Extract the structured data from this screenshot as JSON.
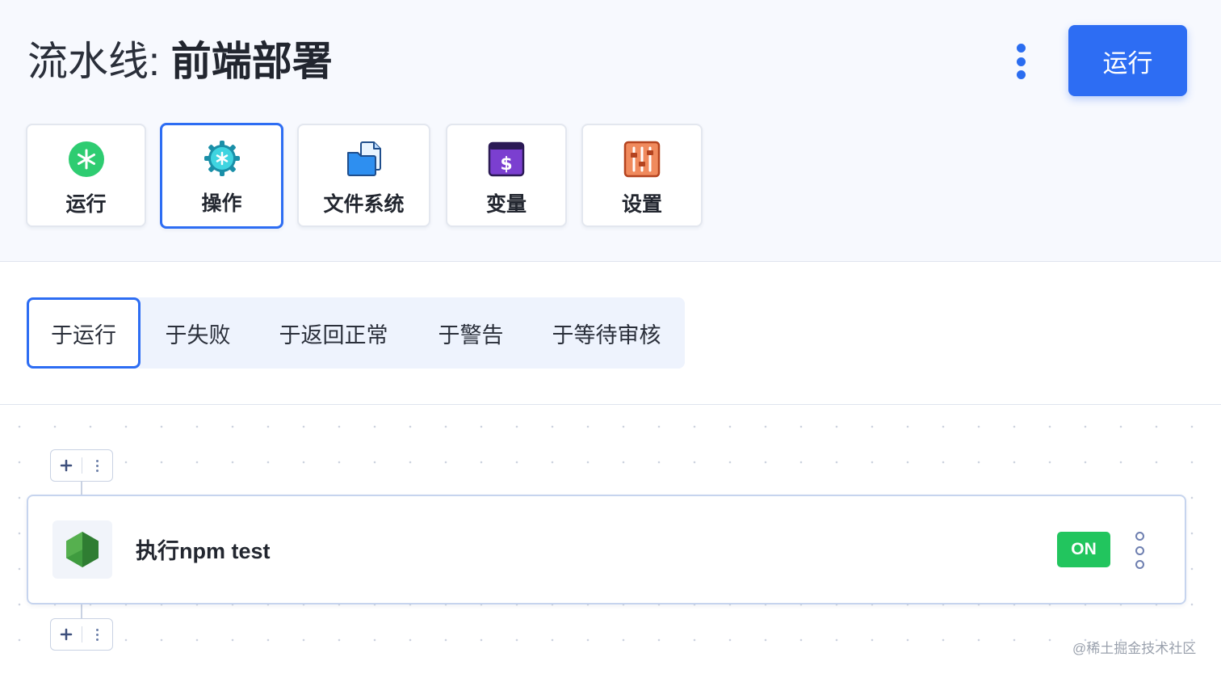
{
  "header": {
    "title_prefix": "流水线: ",
    "title_name": "前端部署",
    "run_button": "运行"
  },
  "tools": [
    {
      "label": "运行",
      "icon": "asterisk-icon",
      "active": false
    },
    {
      "label": "操作",
      "icon": "cog-icon",
      "active": true
    },
    {
      "label": "文件系统",
      "icon": "files-icon",
      "active": false
    },
    {
      "label": "变量",
      "icon": "dollar-icon",
      "active": false
    },
    {
      "label": "设置",
      "icon": "sliders-icon",
      "active": false
    }
  ],
  "tabs": [
    {
      "label": "于运行",
      "active": true
    },
    {
      "label": "于失败",
      "active": false
    },
    {
      "label": "于返回正常",
      "active": false
    },
    {
      "label": "于警告",
      "active": false
    },
    {
      "label": "于等待审核",
      "active": false
    }
  ],
  "step": {
    "name": "执行npm test",
    "icon": "nodejs-icon",
    "toggle": "ON"
  },
  "watermark": "@稀土掘金技术社区",
  "colors": {
    "accent": "#2d6df3",
    "success": "#22c55e",
    "header_bg": "#f7f9fe"
  }
}
